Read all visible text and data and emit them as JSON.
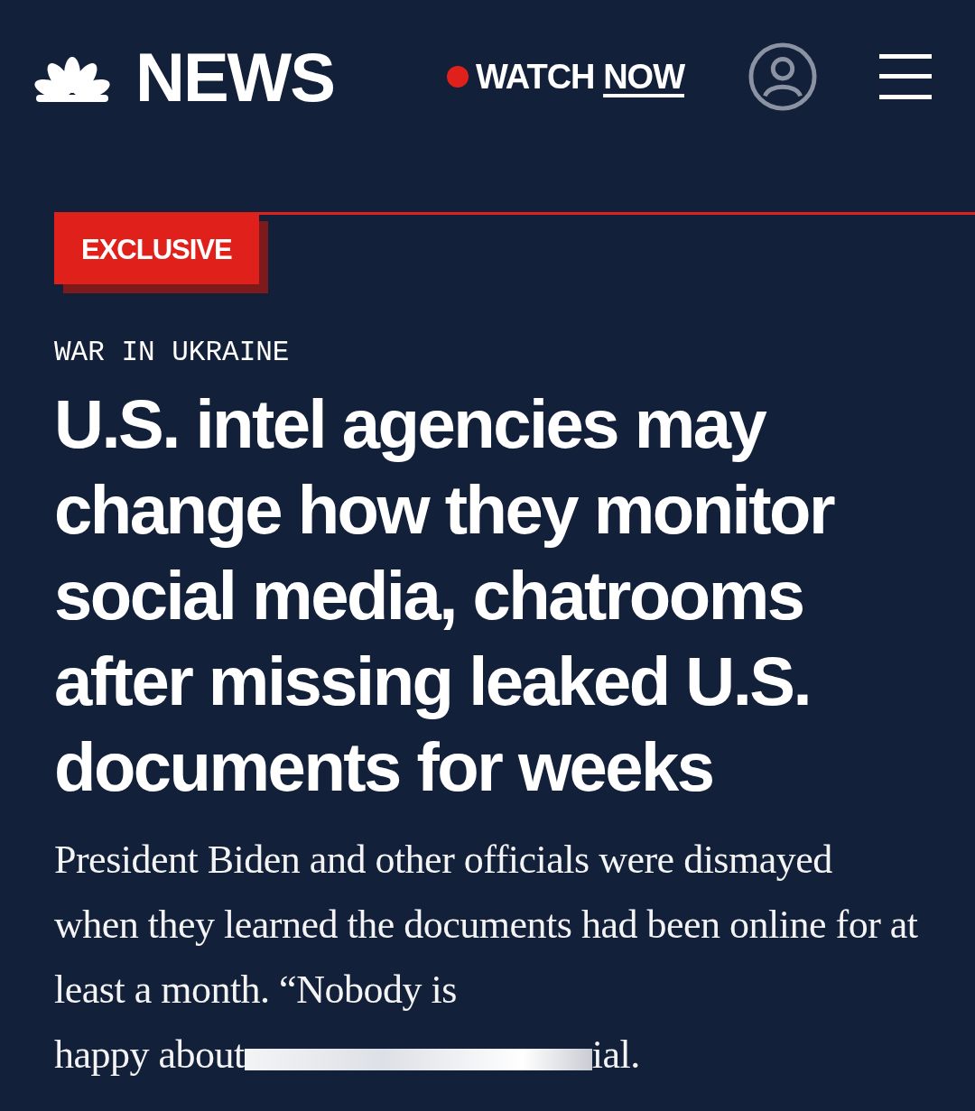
{
  "header": {
    "logo_text": "NEWS",
    "watch": {
      "first": "WATCH",
      "second": "NOW",
      "live": true
    }
  },
  "badge": "EXCLUSIVE",
  "category": "WAR IN UKRAINE",
  "headline": "U.S. intel agencies may change how they monitor social media, chatrooms after missing leaked U.S. documents for weeks",
  "summary": {
    "text": "President Biden and other officials were dismayed when they learned the documents had been online for at least a month. “Nobody is",
    "last_line_start": "happy about",
    "last_line_end": "ial."
  }
}
